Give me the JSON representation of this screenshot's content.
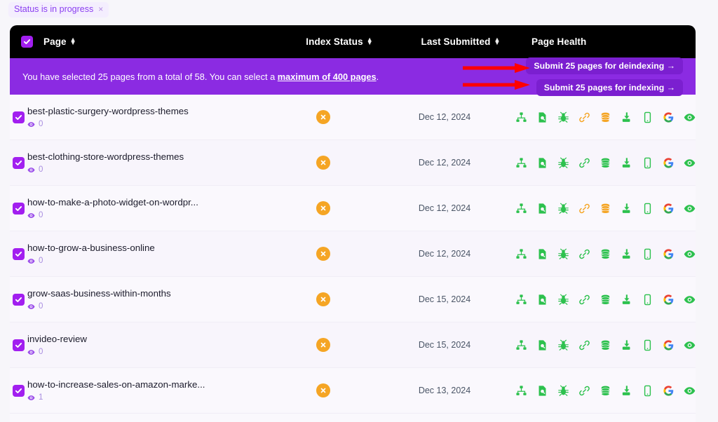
{
  "filter": {
    "chip_label": "Status is in progress",
    "chip_close": "×"
  },
  "colors": {
    "accent_purple": "#8b2be2",
    "checkbox_purple": "#a21ff0",
    "banner_button": "#7b1fd0",
    "status_amber": "#f5a524",
    "health_green": "#2dc14e",
    "health_orange": "#f5a524",
    "arrow_red": "#ff0000",
    "header_black": "#000000"
  },
  "table": {
    "columns": [
      {
        "label": "Page",
        "sortable": true
      },
      {
        "label": "Index Status",
        "sortable": true
      },
      {
        "label": "Last Submitted",
        "sortable": true
      },
      {
        "label": "Page Health",
        "sortable": false
      }
    ],
    "header_checkbox_checked": true
  },
  "banner": {
    "text_before": "You have selected 25 pages from a total of 58. You can select a ",
    "link_text": "maximum of 400 pages",
    "text_after": ".",
    "buttons": [
      {
        "label": "Submit 25 pages for deindexing →"
      },
      {
        "label": "Submit 25 pages for indexing →"
      }
    ]
  },
  "rows": [
    {
      "slug": "best-plastic-surgery-wordpress-themes",
      "views": "0",
      "checked": true,
      "index_status": "not-indexed",
      "date": "Dec 12, 2024",
      "health": [
        "sitemap",
        "file-search",
        "bug",
        "link-orange",
        "database-orange",
        "import",
        "mobile",
        "google",
        "eye"
      ]
    },
    {
      "slug": "best-clothing-store-wordpress-themes",
      "views": "0",
      "checked": true,
      "index_status": "not-indexed",
      "date": "Dec 12, 2024",
      "health": [
        "sitemap",
        "file-search",
        "bug",
        "link",
        "database",
        "import",
        "mobile",
        "google",
        "eye"
      ]
    },
    {
      "slug": "how-to-make-a-photo-widget-on-wordpr...",
      "views": "0",
      "checked": true,
      "index_status": "not-indexed",
      "date": "Dec 12, 2024",
      "health": [
        "sitemap",
        "file-search",
        "bug",
        "link-orange",
        "database-orange",
        "import",
        "mobile",
        "google",
        "eye"
      ]
    },
    {
      "slug": "how-to-grow-a-business-online",
      "views": "0",
      "checked": true,
      "index_status": "not-indexed",
      "date": "Dec 12, 2024",
      "health": [
        "sitemap",
        "file-search",
        "bug",
        "link",
        "database",
        "import",
        "mobile",
        "google",
        "eye"
      ]
    },
    {
      "slug": "grow-saas-business-within-months",
      "views": "0",
      "checked": true,
      "index_status": "not-indexed",
      "date": "Dec 15, 2024",
      "health": [
        "sitemap",
        "file-search",
        "bug",
        "link",
        "database",
        "import",
        "mobile",
        "google",
        "eye"
      ]
    },
    {
      "slug": "invideo-review",
      "views": "0",
      "checked": true,
      "index_status": "not-indexed",
      "date": "Dec 15, 2024",
      "health": [
        "sitemap",
        "file-search",
        "bug",
        "link",
        "database",
        "import",
        "mobile",
        "google",
        "eye"
      ]
    },
    {
      "slug": "how-to-increase-sales-on-amazon-marke...",
      "views": "1",
      "checked": true,
      "index_status": "not-indexed",
      "date": "Dec 13, 2024",
      "health": [
        "sitemap",
        "file-search",
        "bug",
        "link",
        "database",
        "import",
        "mobile",
        "google",
        "eye"
      ]
    }
  ],
  "annotations": {
    "arrows": [
      {
        "target": "Submit 25 pages for deindexing →"
      },
      {
        "target": "Submit 25 pages for indexing →"
      }
    ]
  }
}
